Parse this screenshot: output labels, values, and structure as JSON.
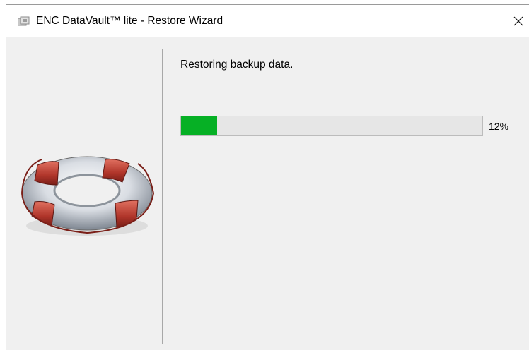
{
  "window": {
    "title": "ENC DataVault™ lite - Restore Wizard",
    "close_icon": "close-icon",
    "app_icon": "encdatavault-app-icon"
  },
  "left_panel": {
    "illustration": "lifebuoy-icon"
  },
  "main": {
    "status_text": "Restoring backup data.",
    "progress": {
      "percent": 12,
      "label": "12%",
      "fill_color": "#06b025",
      "track_color": "#e6e6e6"
    }
  }
}
